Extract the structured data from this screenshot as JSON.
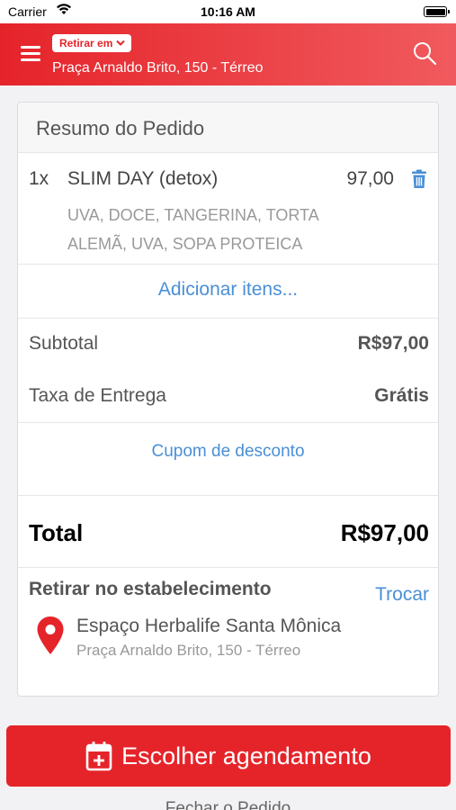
{
  "status_bar": {
    "carrier": "Carrier",
    "time": "10:16 AM"
  },
  "header": {
    "mode_label": "Retirar em",
    "address": "Praça Arnaldo Brito, 150 - Térreo",
    "menu_icon": "hamburger-icon",
    "search_icon": "search-icon",
    "gradient_colors": [
      "#e5242a",
      "#f05a5e"
    ]
  },
  "order": {
    "title": "Resumo do Pedido",
    "items": [
      {
        "qty": "1x",
        "name": "SLIM DAY (detox)",
        "price": "97,00",
        "description": "UVA, DOCE, TANGERINA, TORTA ALEMÃ, UVA, SOPA PROTEICA"
      }
    ],
    "add_items_label": "Adicionar itens...",
    "subtotal_label": "Subtotal",
    "subtotal_value": "R$97,00",
    "fee_label": "Taxa de Entrega",
    "fee_value": "Grátis",
    "coupon_label": "Cupom de desconto",
    "total_label": "Total",
    "total_value": "R$97,00"
  },
  "pickup": {
    "heading": "Retirar no estabelecimento",
    "change_label": "Trocar",
    "store_name": "Espaço Herbalife Santa Mônica",
    "store_address": "Praça Arnaldo Brito, 150 - Térreo",
    "pin_icon": "location-pin-icon"
  },
  "cta": {
    "label": "Escolher agendamento",
    "icon": "calendar-plus-icon"
  },
  "footer": {
    "partial_text": "Fechar o Pedido"
  },
  "colors": {
    "brand_red": "#e5242a",
    "link_blue": "#4a8fd6",
    "muted_text": "#999999"
  }
}
